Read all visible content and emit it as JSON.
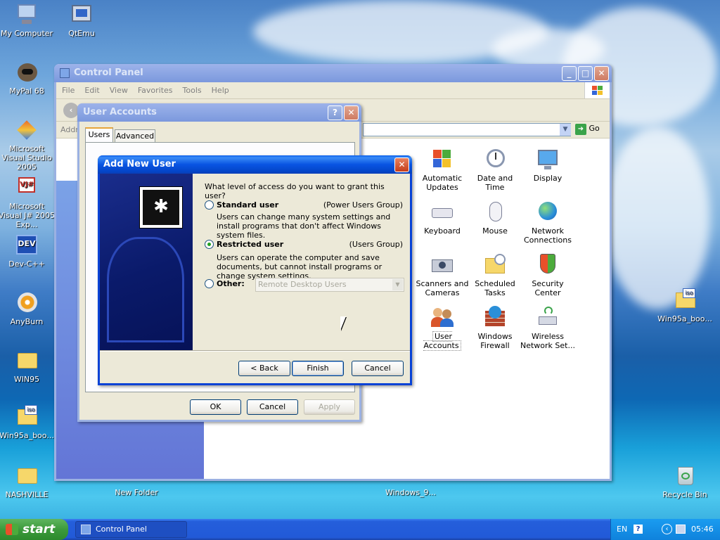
{
  "desktop": {
    "icons": [
      {
        "key": "my_computer",
        "label": "My Computer"
      },
      {
        "key": "qtemu",
        "label": "QtEmu"
      },
      {
        "key": "mypal",
        "label": "MyPal 68"
      },
      {
        "key": "vs2005",
        "label": "Microsoft Visual Studio 2005"
      },
      {
        "key": "vj2005",
        "label": "Microsoft Visual J# 2005 Exp..."
      },
      {
        "key": "devcpp",
        "label": "Dev-C++"
      },
      {
        "key": "anyburn",
        "label": "AnyBurn"
      },
      {
        "key": "win95",
        "label": "WIN95"
      },
      {
        "key": "win95a_left",
        "label": "Win95a_boo..."
      },
      {
        "key": "nashville",
        "label": "NASHVILLE"
      },
      {
        "key": "new_folder",
        "label": "New Folder"
      },
      {
        "key": "windows9",
        "label": "Windows_9..."
      },
      {
        "key": "win95a_right",
        "label": "Win95a_boo..."
      },
      {
        "key": "recycle",
        "label": "Recycle Bin"
      }
    ]
  },
  "control_panel": {
    "title": "Control Panel",
    "menu": [
      "File",
      "Edit",
      "View",
      "Favorites",
      "Tools",
      "Help"
    ],
    "address_label": "Addre",
    "go_label": "Go",
    "items": [
      "Automatic Updates",
      "Date and Time",
      "Display",
      "Keyboard",
      "Mouse",
      "Network Connections",
      "Scanners and Cameras",
      "Scheduled Tasks",
      "Security Center",
      "User Accounts",
      "Windows Firewall",
      "Wireless Network Set..."
    ]
  },
  "user_accounts": {
    "title": "User Accounts",
    "tabs": [
      "Users",
      "Advanced"
    ],
    "ok": "OK",
    "cancel": "Cancel",
    "apply": "Apply"
  },
  "add_user": {
    "title": "Add New User",
    "question": "What level of access do you want to grant this user?",
    "standard": {
      "label": "Standard user",
      "group": "(Power Users Group)",
      "desc": "Users can change many system settings and install programs that don't affect Windows system files."
    },
    "restricted": {
      "label": "Restricted user",
      "group": "(Users Group)",
      "desc": "Users can operate the computer and save documents, but cannot install programs or change system settings."
    },
    "other": {
      "label": "Other:",
      "value": "Remote Desktop Users"
    },
    "back": "< Back",
    "finish": "Finish",
    "cancel": "Cancel"
  },
  "taskbar": {
    "start": "start",
    "task": "Control Panel",
    "lang": "EN",
    "clock": "05:46"
  },
  "colors": {
    "xp_blue": "#0842d6",
    "start_green": "#3c9a3c",
    "taskbar": "#245edb"
  }
}
